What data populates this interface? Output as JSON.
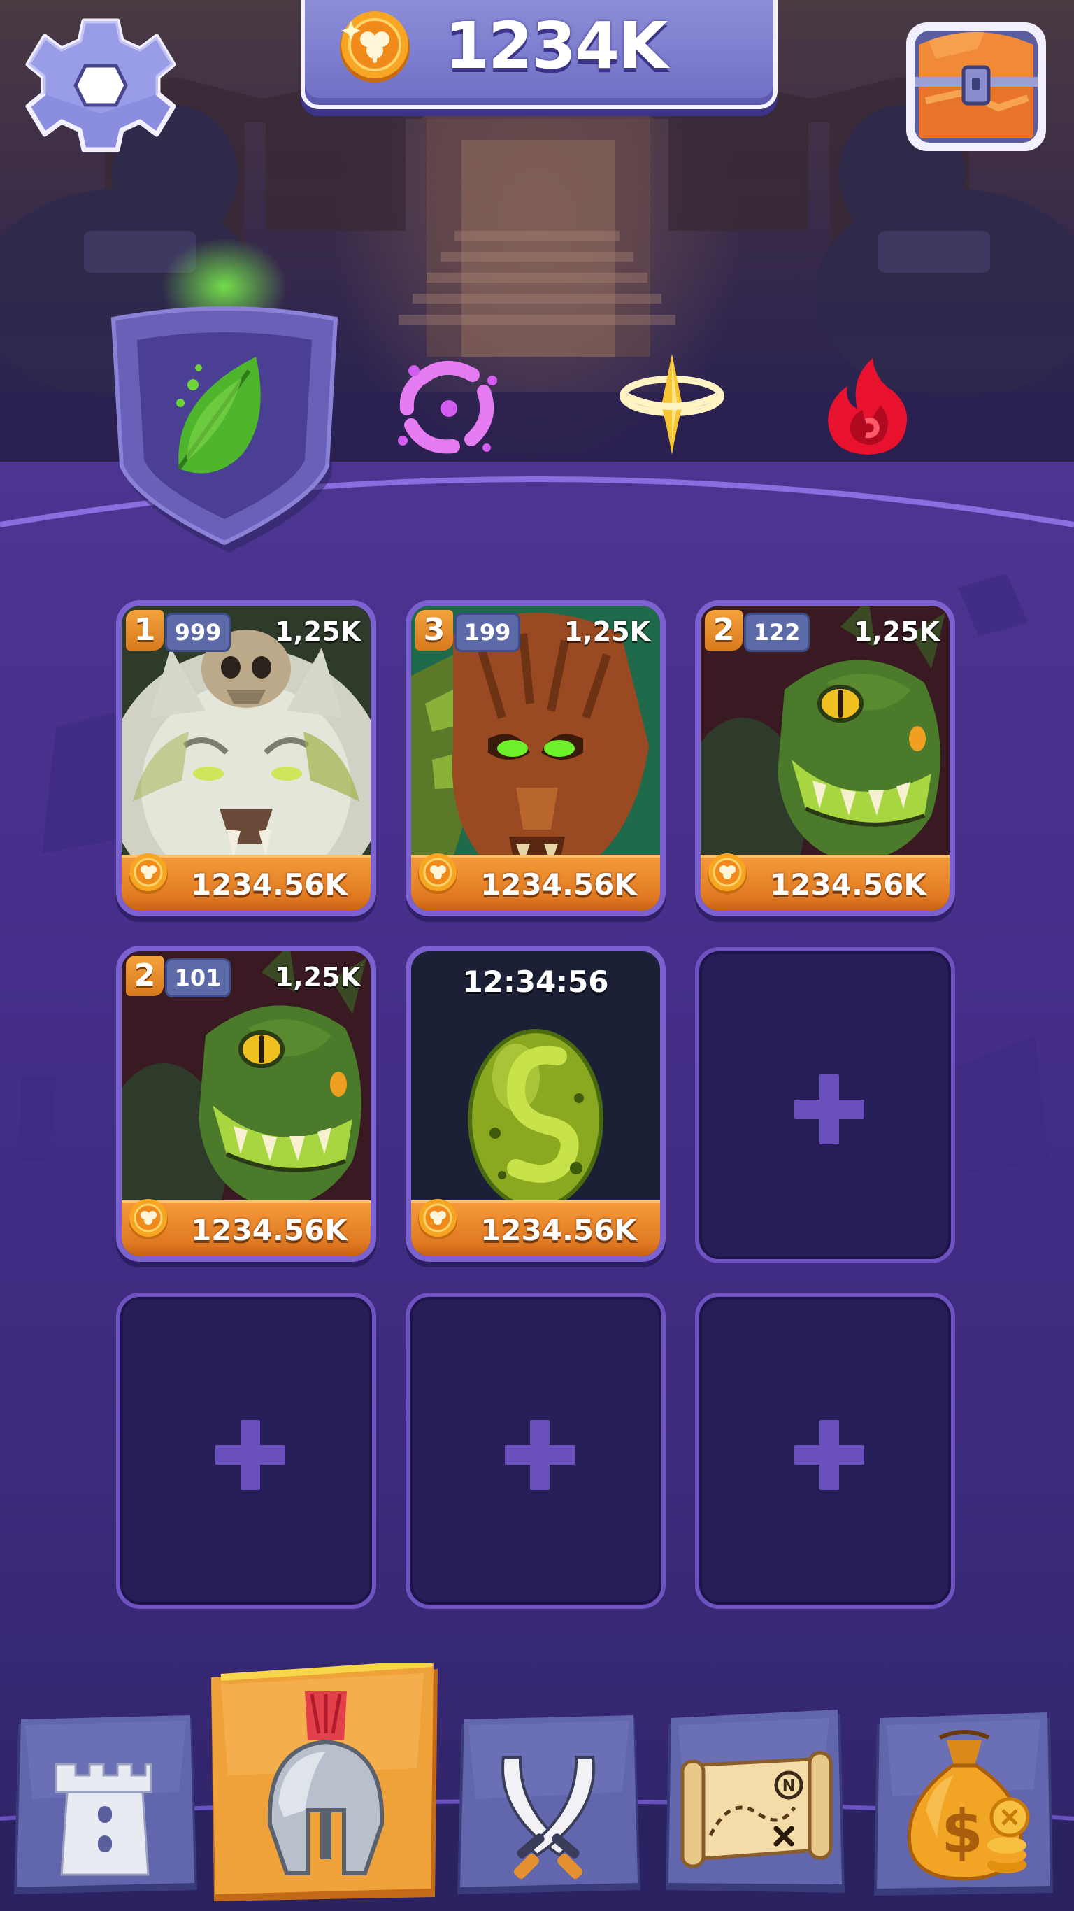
{
  "header": {
    "coins": "1234K",
    "settings_icon": "gear-icon",
    "chest_icon": "treasure-chest-icon"
  },
  "element_tabs": [
    {
      "name": "nature",
      "icon": "leaf-icon",
      "selected": true,
      "color": "#58c63a"
    },
    {
      "name": "void",
      "icon": "void-vortex-icon",
      "selected": false,
      "color": "#d35cf0"
    },
    {
      "name": "light",
      "icon": "light-halo-icon",
      "selected": false,
      "color": "#f6c531"
    },
    {
      "name": "fire",
      "icon": "fire-icon",
      "selected": false,
      "color": "#e8122e"
    }
  ],
  "slots": [
    {
      "type": "monster",
      "level": "1",
      "count": "999",
      "rate": "1,25K",
      "price": "1234.56K",
      "art": "white-wolf-skull-monster"
    },
    {
      "type": "monster",
      "level": "3",
      "count": "199",
      "rate": "1,25K",
      "price": "1234.56K",
      "art": "tree-ent-monster"
    },
    {
      "type": "monster",
      "level": "2",
      "count": "122",
      "rate": "1,25K",
      "price": "1234.56K",
      "art": "green-dragon-monster"
    },
    {
      "type": "monster",
      "level": "2",
      "count": "101",
      "rate": "1,25K",
      "price": "1234.56K",
      "art": "green-dragon-monster"
    },
    {
      "type": "egg",
      "timer": "12:34:56",
      "price": "1234.56K",
      "art": "green-egg"
    },
    {
      "type": "empty",
      "icon": "plus-icon"
    },
    {
      "type": "empty",
      "icon": "plus-icon"
    },
    {
      "type": "empty",
      "icon": "plus-icon"
    },
    {
      "type": "empty",
      "icon": "plus-icon"
    }
  ],
  "nav": [
    {
      "icon": "castle-tower-icon",
      "selected": false
    },
    {
      "icon": "spartan-helmet-icon",
      "selected": true
    },
    {
      "icon": "crossed-swords-icon",
      "selected": false
    },
    {
      "icon": "treasure-map-icon",
      "selected": false
    },
    {
      "icon": "money-bag-icon",
      "selected": false
    }
  ],
  "colors": {
    "background": "#452f8a",
    "card_border": "#7b62d0",
    "empty_slot": "#271d57",
    "price_bar": "#e07a22",
    "nav_selected": "#f0a23a",
    "nav_button": "#5d60a8"
  }
}
